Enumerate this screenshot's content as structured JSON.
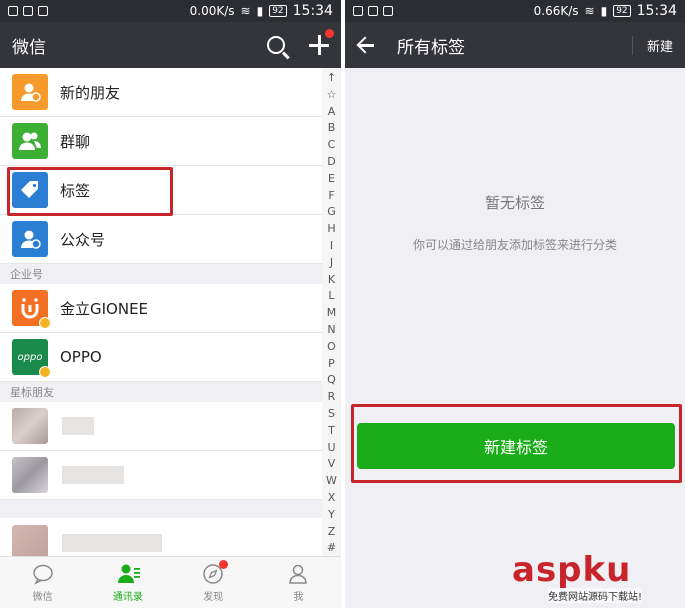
{
  "left": {
    "status": {
      "speed": "0.00K/s",
      "battery": "92",
      "time": "15:34"
    },
    "appbar": {
      "title": "微信"
    },
    "top_items": [
      {
        "label": "新的朋友",
        "color": "#f79a2b",
        "icon": "person-add-icon"
      },
      {
        "label": "群聊",
        "color": "#3cb034",
        "icon": "group-icon"
      },
      {
        "label": "标签",
        "color": "#2a7fd4",
        "icon": "tag-icon"
      },
      {
        "label": "公众号",
        "color": "#2a7fd4",
        "icon": "official-account-icon"
      }
    ],
    "enterprise_section": "企业号",
    "enterprise_items": [
      {
        "label": "金立GIONEE"
      },
      {
        "label": "OPPO",
        "logo_text": "oppo"
      }
    ],
    "starred_section": "星标朋友",
    "index_letters": [
      "↑",
      "☆",
      "A",
      "B",
      "C",
      "D",
      "E",
      "F",
      "G",
      "H",
      "I",
      "J",
      "K",
      "L",
      "M",
      "N",
      "O",
      "P",
      "Q",
      "R",
      "S",
      "T",
      "U",
      "V",
      "W",
      "X",
      "Y",
      "Z",
      "#"
    ],
    "tabs": [
      {
        "label": "微信",
        "active": false
      },
      {
        "label": "通讯录",
        "active": true
      },
      {
        "label": "发现",
        "active": false
      },
      {
        "label": "我",
        "active": false
      }
    ]
  },
  "right": {
    "status": {
      "speed": "0.66K/s",
      "battery": "92",
      "time": "15:34"
    },
    "appbar": {
      "title": "所有标签",
      "new_label": "新建"
    },
    "empty_title": "暂无标签",
    "empty_desc": "你可以通过给朋友添加标签来进行分类",
    "new_tag_button": "新建标签"
  },
  "watermark": {
    "main": "aspku",
    "sub": "免费网站源码下载站!"
  },
  "colors": {
    "accent_green": "#1aad19",
    "highlight_red": "#c8242b",
    "bar_dark": "#34353a"
  }
}
